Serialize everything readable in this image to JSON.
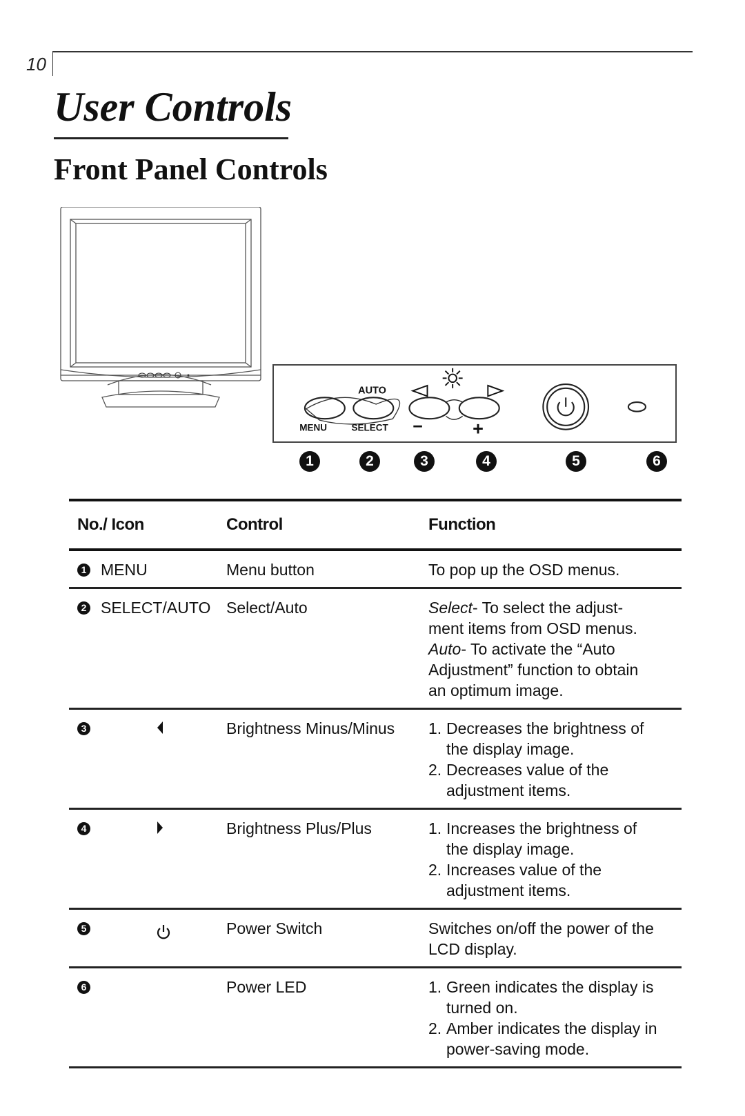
{
  "page": {
    "number": "10",
    "title": "User Controls",
    "subtitle": "Front Panel Controls"
  },
  "panel": {
    "labels": {
      "auto": "AUTO",
      "menu": "MENU",
      "select": "SELECT",
      "minus": "−",
      "plus": "+"
    },
    "icons": [
      "brightness-icon",
      "left-triangle-icon",
      "right-triangle-icon",
      "power-icon",
      "led-icon"
    ],
    "callouts": [
      "1",
      "2",
      "3",
      "4",
      "5",
      "6"
    ]
  },
  "table": {
    "headers": {
      "no_icon": "No./ Icon",
      "control": "Control",
      "function": "Function"
    },
    "rows": [
      {
        "no": "1",
        "icon_label": "MENU",
        "icon": "",
        "control": "Menu button",
        "function_lines": [
          "To pop up the OSD menus."
        ]
      },
      {
        "no": "2",
        "icon_label": "SELECT/AUTO",
        "icon": "",
        "control": "Select/Auto",
        "function_select_term": "Select",
        "function_select_text": "- To select the adjust-",
        "function_select_text2": "ment items from OSD menus.",
        "function_auto_term": "Auto",
        "function_auto_text": "- To activate the “Auto",
        "function_auto_text2": "Adjustment” function to obtain",
        "function_auto_text3": "an optimum image."
      },
      {
        "no": "3",
        "icon_label": "",
        "icon": "left-triangle-icon",
        "control": "Brightness Minus/Minus",
        "items": [
          {
            "n": "1.",
            "lines": [
              "Decreases the brightness of",
              "the display image."
            ]
          },
          {
            "n": "2.",
            "lines": [
              "Decreases value of the",
              "adjustment items."
            ]
          }
        ]
      },
      {
        "no": "4",
        "icon_label": "",
        "icon": "right-triangle-icon",
        "control": "Brightness Plus/Plus",
        "items": [
          {
            "n": "1.",
            "lines": [
              "Increases the brightness of",
              "the display image."
            ]
          },
          {
            "n": "2.",
            "lines": [
              "Increases value of the",
              "adjustment items."
            ]
          }
        ]
      },
      {
        "no": "5",
        "icon_label": "",
        "icon": "power-icon",
        "control": "Power Switch",
        "function_lines": [
          "Switches on/off the power of the",
          "LCD display."
        ]
      },
      {
        "no": "6",
        "icon_label": "",
        "icon": "",
        "control": "Power LED",
        "items": [
          {
            "n": "1.",
            "lines": [
              "Green indicates the display is",
              "turned on."
            ]
          },
          {
            "n": "2.",
            "lines": [
              "Amber indicates the display in",
              "power-saving mode."
            ]
          }
        ]
      }
    ]
  }
}
